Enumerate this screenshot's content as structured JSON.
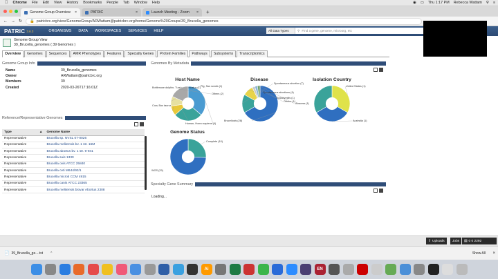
{
  "mac": {
    "apple": "",
    "app": "Chrome",
    "menus": [
      "File",
      "Edit",
      "View",
      "History",
      "Bookmarks",
      "People",
      "Tab",
      "Window",
      "Help"
    ],
    "datetime": "Thu 1:17 PM",
    "user": "Rebecca Wattam"
  },
  "browser": {
    "tabs": [
      {
        "label": "Genome Group Overview",
        "active": true,
        "favicon": "#3b6fb3"
      },
      {
        "label": "PATRIC",
        "active": false,
        "favicon": "#3b6fb3"
      },
      {
        "label": "Launch Meeting - Zoom",
        "active": false,
        "favicon": "#2d8cff"
      }
    ],
    "url": "patricbrc.org/view/GenomeGroup/ARWattam@patricbrc.org/home/Genome%20Groups/39_Brucella_genomes"
  },
  "patric": {
    "logo": "PATRIC",
    "version": "3.6.3",
    "nav": [
      "ORGANISMS",
      "DATA",
      "WORKSPACES",
      "SERVICES",
      "HELP"
    ],
    "search_type": "All Data Types",
    "search_placeholder": "Find a gene, genome, microorg, etc"
  },
  "group": {
    "kind": "Genome Group View",
    "title": "39_Brucella_genomes ( 39 Genomes )"
  },
  "tabs": [
    "Overview",
    "Genomes",
    "Sequences",
    "AMR Phenotypes",
    "Features",
    "Specialty Genes",
    "Protein Families",
    "Pathways",
    "Subsystems",
    "Transcriptomics"
  ],
  "info": {
    "heading": "Genome Group Info",
    "rows": [
      {
        "k": "Name",
        "v": "39_Brucella_genomes"
      },
      {
        "k": "Owner",
        "v": "ARWattam@patricbrc.org"
      },
      {
        "k": "Members",
        "v": "39"
      },
      {
        "k": "Created",
        "v": "2020-03-26T17:16:01Z"
      }
    ]
  },
  "ref": {
    "heading": "Reference/Representative Genomes",
    "columns": [
      "Type",
      "Genome Name"
    ],
    "rows": [
      [
        "Representative",
        "Brucella sp. NVSL 07-0026"
      ],
      [
        "Representative",
        "Brucella melitensis bv. 1 str. 16M"
      ],
      [
        "Representative",
        "Brucella abortus bv. 1 str. 9-941"
      ],
      [
        "Representative",
        "Brucella suis 1330"
      ],
      [
        "Representative",
        "Brucella ovis ATCC 25840"
      ],
      [
        "Representative",
        "Brucella ceti M644/93/1"
      ],
      [
        "Representative",
        "Brucella microti CCM 4915"
      ],
      [
        "Representative",
        "Brucella canis ATCC 23365"
      ],
      [
        "Representative",
        "Brucella melitensis biovar Abortus 2308"
      ]
    ]
  },
  "metadata": {
    "heading": "Genomes By Metadata",
    "charts": [
      {
        "title": "Host Name",
        "slices": [
          {
            "label": "Human, Homo sapiens (4)",
            "value": 4,
            "color": "#4a9bd1"
          },
          {
            "label": "Cow, Bos taurus (3)",
            "value": 3,
            "color": "#3aa39a"
          },
          {
            "label": "Bottlenose dolphin, Tursiops truncatus (1)",
            "value": 1,
            "color": "#e8c83a"
          },
          {
            "label": "Pig, Sus scrofa (1)",
            "value": 1,
            "color": "#e6e0a0"
          },
          {
            "label": "Others (2)",
            "value": 2,
            "color": "#a8a8a8"
          }
        ]
      },
      {
        "title": "Disease",
        "slices": [
          {
            "label": "Brucellosis (28)",
            "value": 28,
            "color": "#2f6fc0"
          },
          {
            "label": "Spontaneous abortion (7)",
            "value": 7,
            "color": "#3aa39a"
          },
          {
            "label": "Spontaneous abortions (4)",
            "value": 4,
            "color": "#e8d44a"
          },
          {
            "label": "Epididymitis (1)",
            "value": 1,
            "color": "#c9c9c9"
          },
          {
            "label": "Others (1)",
            "value": 1,
            "color": "#8ab8d8"
          },
          {
            "label": "Abscess (1)",
            "value": 1,
            "color": "#6d9f6d"
          }
        ]
      },
      {
        "title": "Isolation Country",
        "slices": [
          {
            "label": "United States (1)",
            "value": 1,
            "color": "#dfe24a"
          },
          {
            "label": "Australia (1)",
            "value": 1,
            "color": "#2f6fc0"
          },
          {
            "label": "",
            "value": 1,
            "color": "#3aa39a"
          }
        ]
      },
      {
        "title": "Genome Status",
        "slices": [
          {
            "label": "Complete (10)",
            "value": 10,
            "color": "#3aa39a"
          },
          {
            "label": "WGS (29)",
            "value": 29,
            "color": "#2f6fc0"
          }
        ]
      }
    ]
  },
  "specialty": {
    "heading": "Specialty Gene Summary",
    "status": "Loading..."
  },
  "bottom": {
    "uploads": "Uploads",
    "jobs": "Jobs",
    "jobs_counts": "0  0  2292"
  },
  "download": {
    "file": "39_Brucella_ge....txt",
    "show_all": "Show All"
  }
}
